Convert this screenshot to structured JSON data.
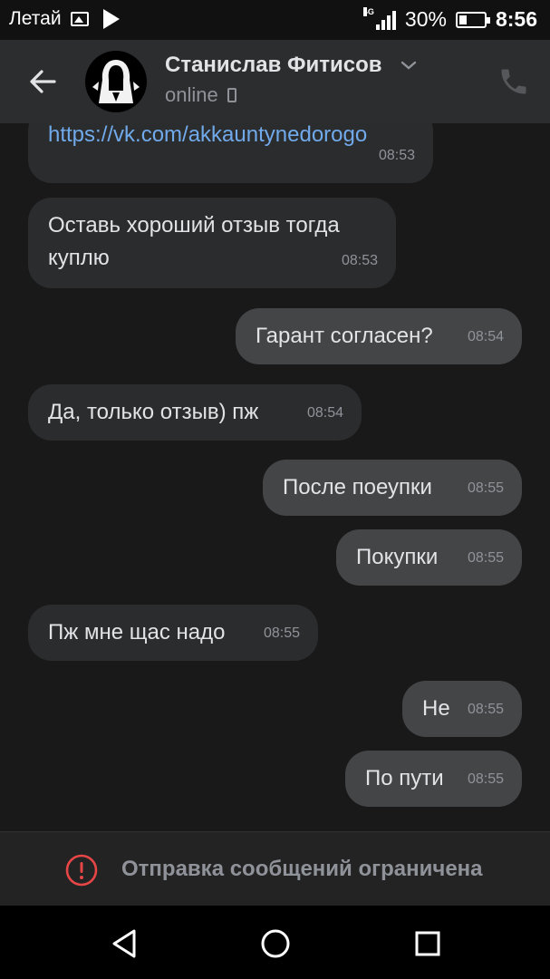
{
  "status_bar": {
    "carrier": "Летай",
    "network": "4G",
    "battery_percent": "30%",
    "battery_level": 0.3,
    "clock": "8:56",
    "icons": [
      "photo-icon",
      "play-store-icon",
      "signal-icon",
      "battery-icon"
    ]
  },
  "header": {
    "contact_name": "Станислав Фитисов",
    "status": "online",
    "icons": [
      "back-arrow-icon",
      "chevron-down-icon",
      "mobile-phone-icon",
      "call-icon"
    ]
  },
  "messages": [
    {
      "direction": "in",
      "text": "https://vk.com/akkauntynedorogo",
      "is_link": true,
      "time": "08:53"
    },
    {
      "direction": "in",
      "text": "Оставь хороший отзыв тогда куплю",
      "time": "08:53"
    },
    {
      "direction": "out",
      "text": "Гарант согласен?",
      "time": "08:54"
    },
    {
      "direction": "in",
      "text": "Да, только отзыв) пж",
      "time": "08:54"
    },
    {
      "direction": "out",
      "text": "После поеупки",
      "time": "08:55"
    },
    {
      "direction": "out",
      "text": "Покупки",
      "time": "08:55"
    },
    {
      "direction": "in",
      "text": "Пж мне щас надо",
      "time": "08:55"
    },
    {
      "direction": "out",
      "text": "Не",
      "time": "08:55"
    },
    {
      "direction": "out",
      "text": "По пути",
      "time": "08:55"
    }
  ],
  "restriction": {
    "text": "Отправка сообщений ограничена",
    "icon": "exclamation-circle-icon",
    "color": "#e64646"
  },
  "colors": {
    "link": "#71aaeb",
    "incoming_bubble": "#2b2c2e",
    "outgoing_bubble": "#444547"
  },
  "nav_bar": {
    "icons": [
      "back-triangle-icon",
      "home-circle-icon",
      "recents-square-icon"
    ]
  }
}
